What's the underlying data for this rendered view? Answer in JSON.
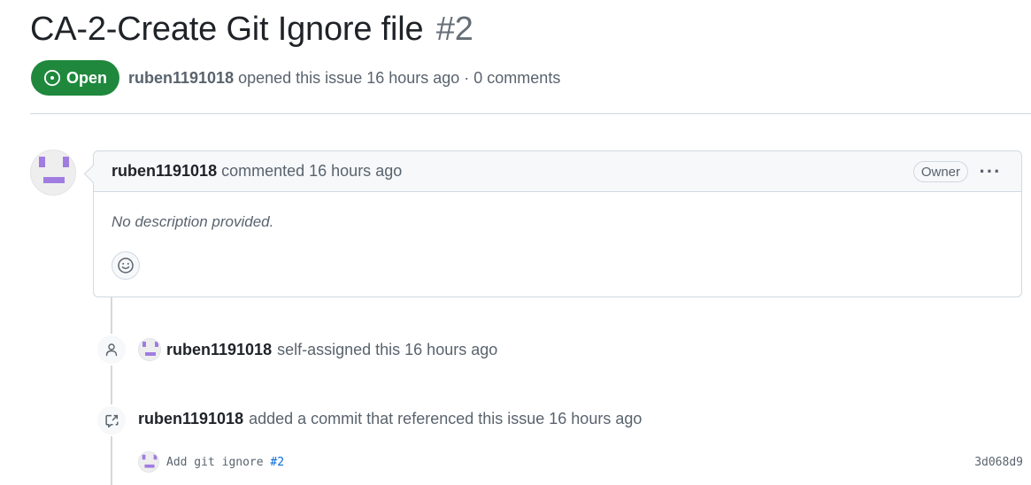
{
  "issue": {
    "title": "CA-2-Create Git Ignore file",
    "number": "#2",
    "state": "Open",
    "author": "ruben1191018",
    "opened_text": "opened this issue 16 hours ago · 0 comments"
  },
  "comment": {
    "author": "ruben1191018",
    "action": "commented 16 hours ago",
    "role_badge": "Owner",
    "menu_label": "···",
    "body": "No description provided."
  },
  "timeline": [
    {
      "author": "ruben1191018",
      "text": "self-assigned this 16 hours ago",
      "icon": "person-icon"
    },
    {
      "author": "ruben1191018",
      "text": "added a commit that referenced this issue 16 hours ago",
      "icon": "cross-reference-icon"
    }
  ],
  "commit": {
    "message": "Add git ignore",
    "ref": "#2",
    "sha": "3d068d9"
  },
  "colors": {
    "open_green": "#1f883d",
    "link_blue": "#0969da",
    "avatar_purple": "#a07ce0"
  }
}
